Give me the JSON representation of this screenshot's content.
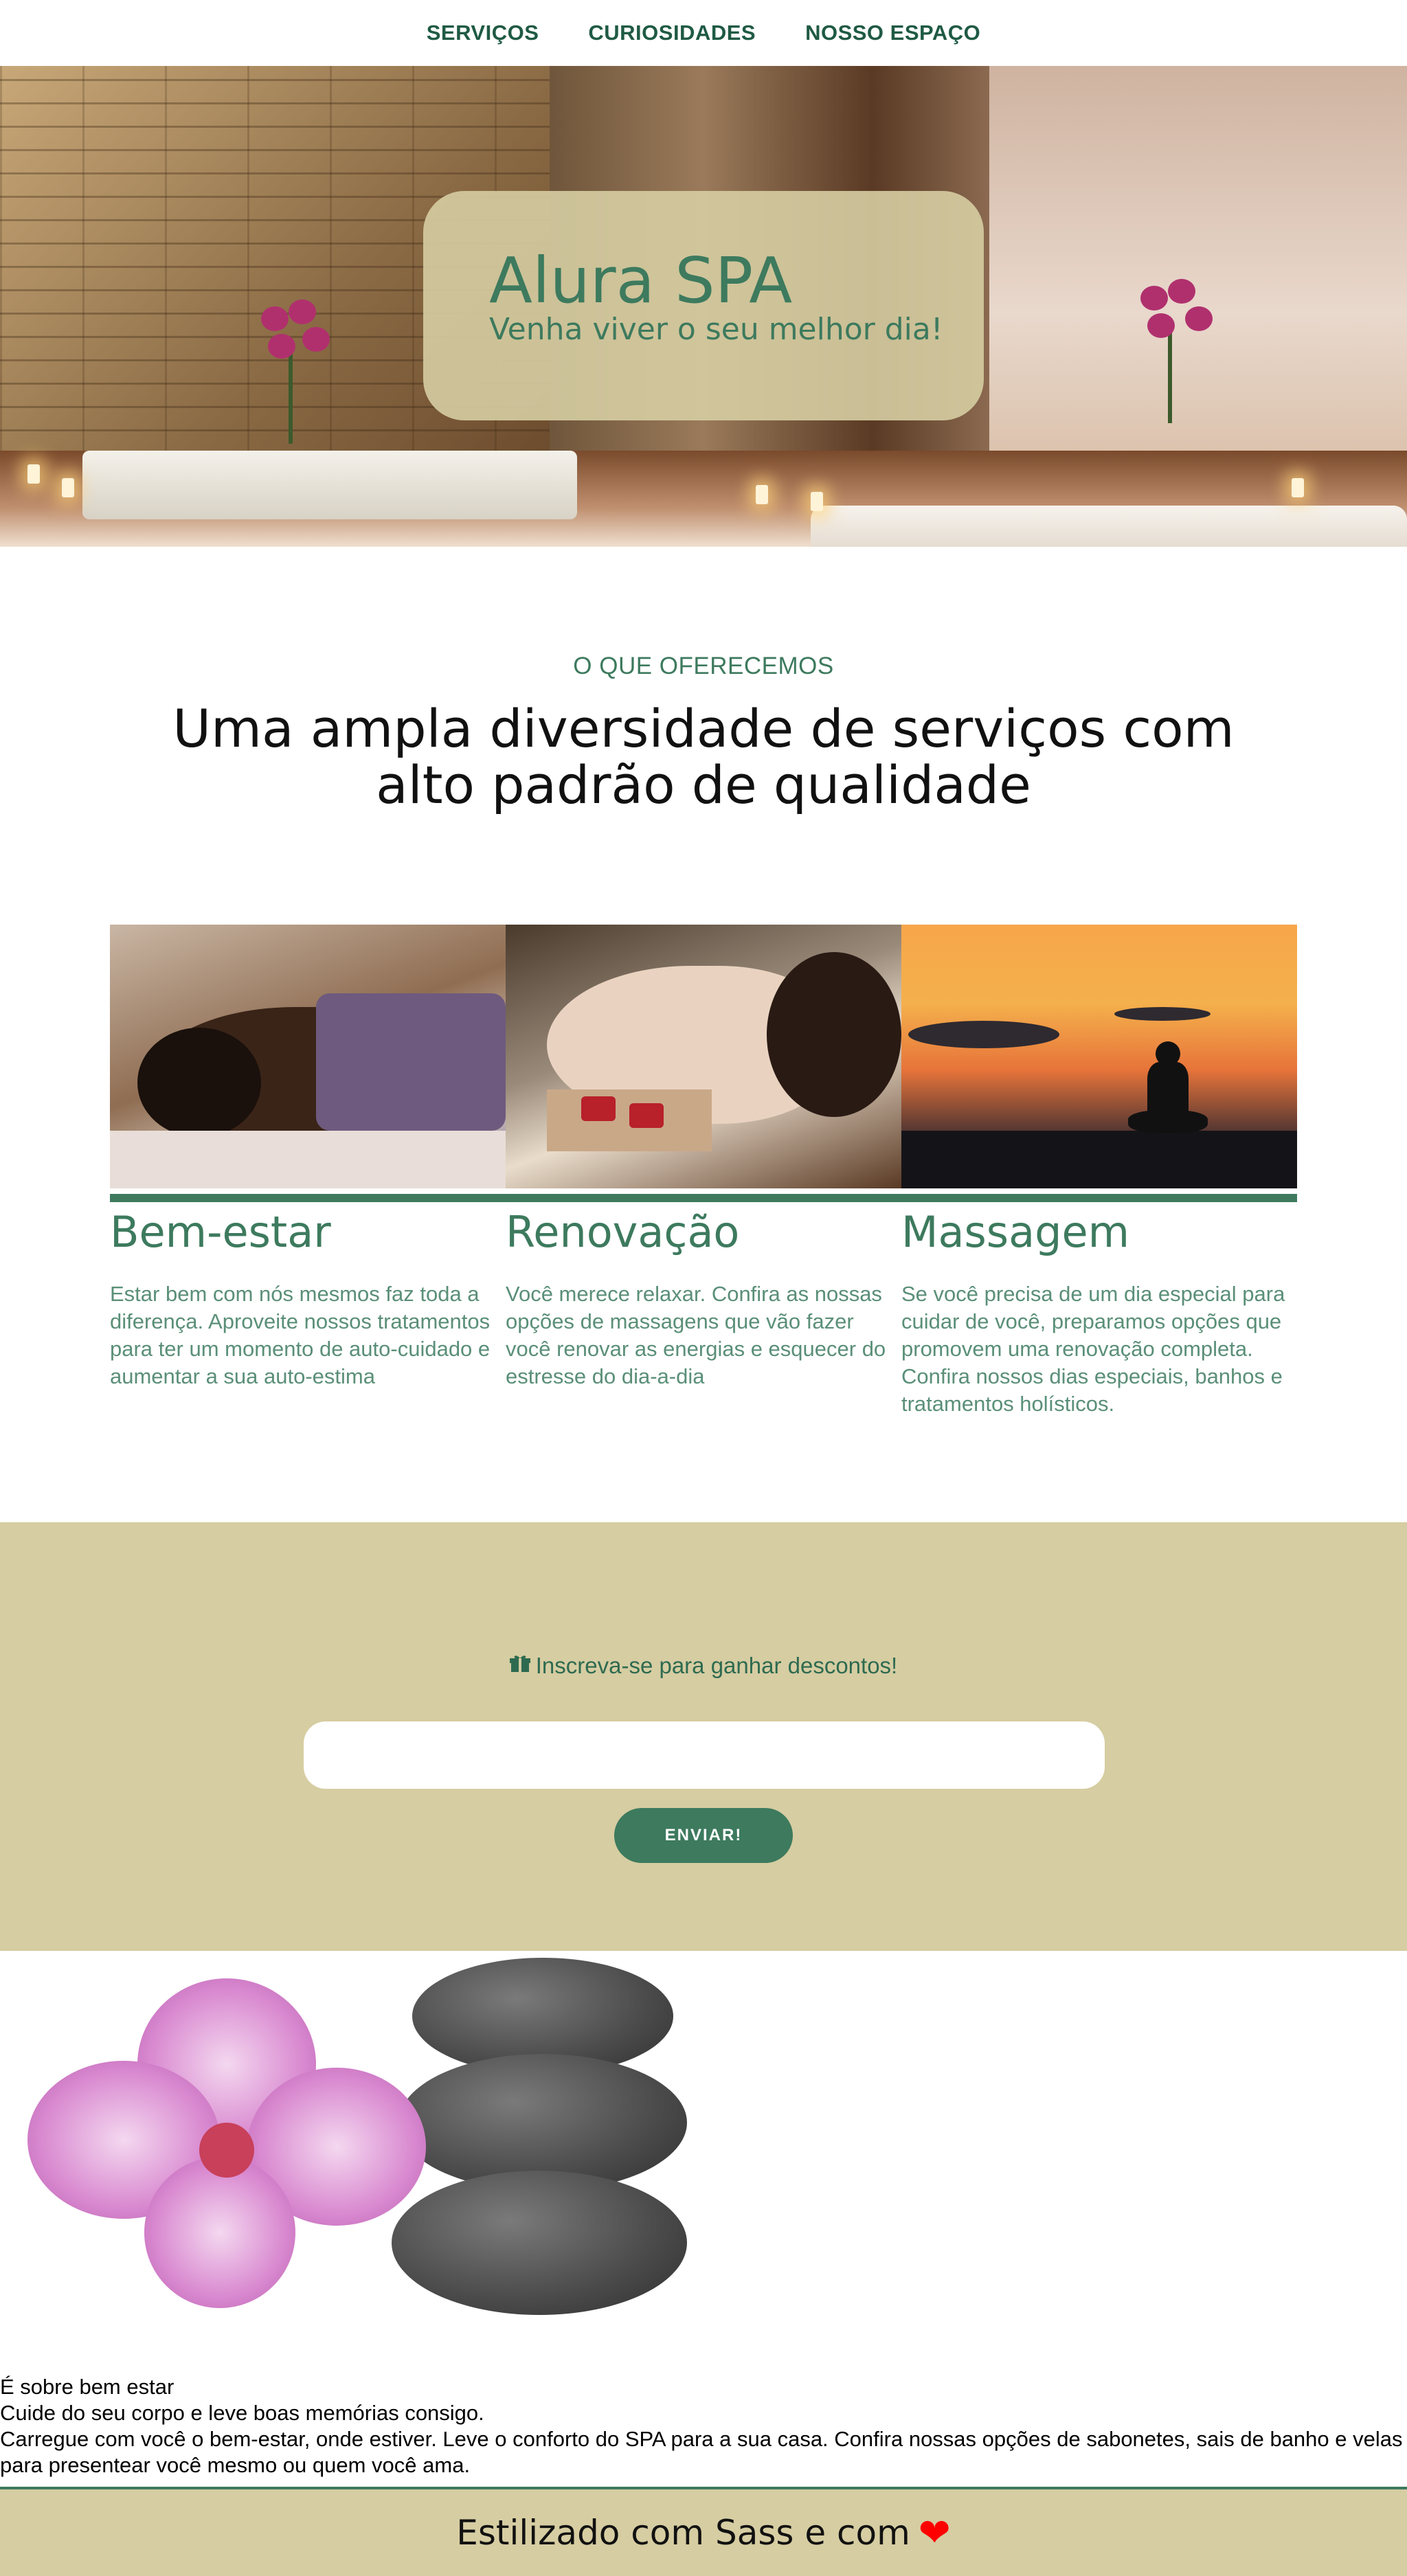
{
  "nav": {
    "items": [
      "SERVIÇOS",
      "CURIOSIDADES",
      "NOSSO ESPAÇO"
    ]
  },
  "hero": {
    "title": "Alura SPA",
    "subtitle": "Venha viver o seu melhor dia!"
  },
  "services": {
    "kicker": "O QUE OFERECEMOS",
    "headline": "Uma ampla diversidade de serviços com alto padrão de qualidade",
    "items": [
      {
        "title": "Bem-estar",
        "text": "Estar bem com nós mesmos faz toda a diferença. Aproveite nossos tratamentos para ter um momento de auto-cuidado e aumentar a sua auto-estima"
      },
      {
        "title": "Renovação",
        "text": "Você merece relaxar. Confira as nossas opções de massagens que vão fazer você renovar as energias e esquecer do estresse do dia-a-dia"
      },
      {
        "title": "Massagem",
        "text": "Se você precisa de um dia especial para cuidar de você, preparamos opções que promovem uma renovação completa. Confira nossos dias especiais, banhos e tratamentos holísticos."
      }
    ]
  },
  "newsletter": {
    "label": "Inscreva-se para ganhar descontos!",
    "input_value": "",
    "button": "ENVIAR!"
  },
  "about": {
    "line1": "É sobre bem estar",
    "line2": "Cuide do seu corpo e leve boas memórias consigo.",
    "line3": "Carregue com você o bem-estar, onde estiver. Leve o conforto do SPA para a sua casa. Confira nossas opções de sabonetes, sais de banho e velas para presentear você mesmo ou quem você ama."
  },
  "footer": {
    "text": "Estilizado com Sass e com",
    "heart": "❤"
  },
  "colors": {
    "accent": "#3d7a5e",
    "beige": "#d6cda2",
    "heart": "#ff0000"
  }
}
